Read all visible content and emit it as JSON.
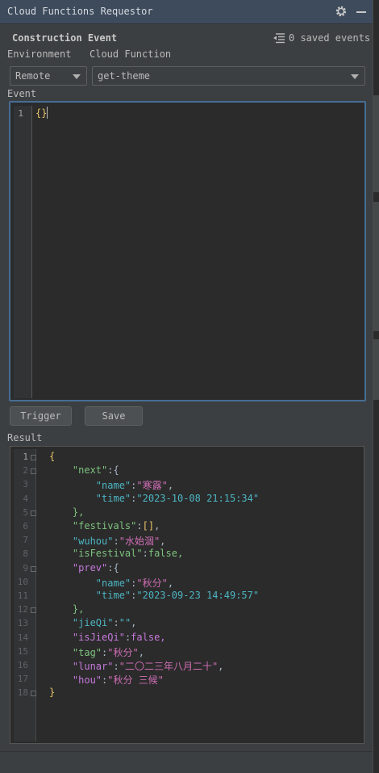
{
  "window": {
    "title": "Cloud Functions Requestor"
  },
  "construction": {
    "title": "Construction Event",
    "saved_events": "0 saved events"
  },
  "environment": {
    "label": "Environment",
    "value": "Remote"
  },
  "cloud_function": {
    "label": "Cloud Function",
    "value": "get-theme"
  },
  "event": {
    "label": "Event",
    "line_number": "1",
    "content": "{}"
  },
  "buttons": {
    "trigger": "Trigger",
    "save": "Save"
  },
  "result": {
    "label": "Result",
    "lines": [
      {
        "n": "1",
        "t": "{"
      },
      {
        "n": "2",
        "t": "    \"next\":{"
      },
      {
        "n": "3",
        "t": "        \"name\":\"寒露\","
      },
      {
        "n": "4",
        "t": "        \"time\":\"2023-10-08 21:15:34\""
      },
      {
        "n": "5",
        "t": "    },"
      },
      {
        "n": "6",
        "t": "    \"festivals\":[],"
      },
      {
        "n": "7",
        "t": "    \"wuhou\":\"水始涸\","
      },
      {
        "n": "8",
        "t": "    \"isFestival\":false,"
      },
      {
        "n": "9",
        "t": "    \"prev\":{"
      },
      {
        "n": "10",
        "t": "        \"name\":\"秋分\","
      },
      {
        "n": "11",
        "t": "        \"time\":\"2023-09-23 14:49:57\""
      },
      {
        "n": "12",
        "t": "    },"
      },
      {
        "n": "13",
        "t": "    \"jieQi\":\"\","
      },
      {
        "n": "14",
        "t": "    \"isJieQi\":false,"
      },
      {
        "n": "15",
        "t": "    \"tag\":\"秋分\","
      },
      {
        "n": "16",
        "t": "    \"lunar\":\"二〇二三年八月二十\","
      },
      {
        "n": "17",
        "t": "    \"hou\":\"秋分 三候\""
      },
      {
        "n": "18",
        "t": "}"
      }
    ]
  }
}
